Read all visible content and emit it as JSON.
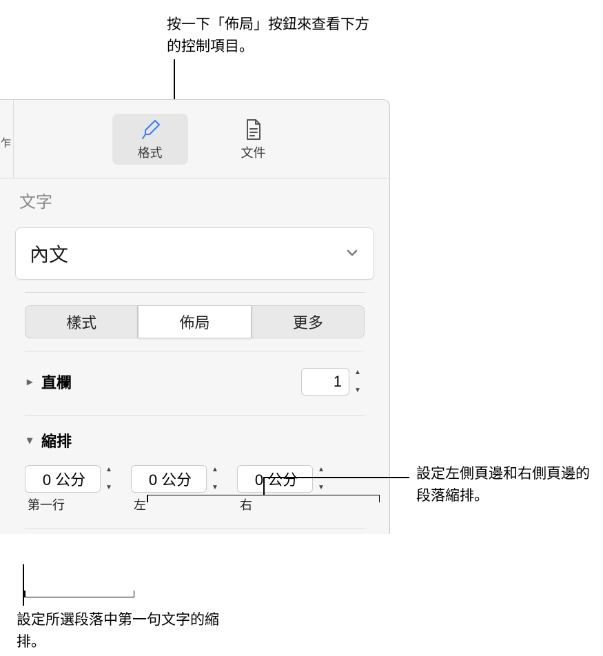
{
  "callouts": {
    "top": "按一下「佈局」按鈕來查看下方的控制項目。",
    "right": "設定左側頁邊和右側頁邊的段落縮排。",
    "bottom": "設定所選段落中第一句文字的縮排。"
  },
  "toolbar": {
    "partial_label": "乍",
    "format_label": "格式",
    "document_label": "文件"
  },
  "section_title": "文字",
  "paragraph_style": {
    "value": "內文"
  },
  "tabs": {
    "style": "樣式",
    "layout": "佈局",
    "more": "更多"
  },
  "columns": {
    "label": "直欄",
    "value": "1"
  },
  "indent": {
    "label": "縮排",
    "items": [
      {
        "value": "0 公分",
        "label": "第一行"
      },
      {
        "value": "0 公分",
        "label": "左"
      },
      {
        "value": "0 公分",
        "label": "右"
      }
    ]
  }
}
